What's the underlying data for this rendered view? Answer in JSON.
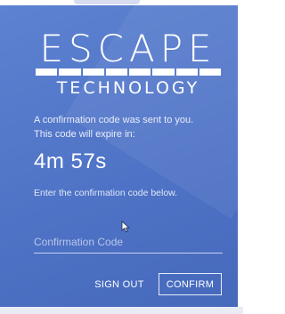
{
  "logo": {
    "title": "ESCAPE",
    "subtitle": "TECHNOLOGY"
  },
  "message": {
    "line1": "A confirmation code was sent to you.",
    "line2": "This code will expire in:"
  },
  "timer": "4m 57s",
  "instruction": "Enter the confirmation code below.",
  "code_input": {
    "placeholder": "Confirmation Code",
    "value": ""
  },
  "buttons": {
    "sign_out": "SIGN OUT",
    "confirm": "CONFIRM"
  },
  "colors": {
    "card_background": "#5277c9",
    "text": "#ffffff"
  },
  "icons": {
    "cursor": "mouse-pointer-icon"
  }
}
